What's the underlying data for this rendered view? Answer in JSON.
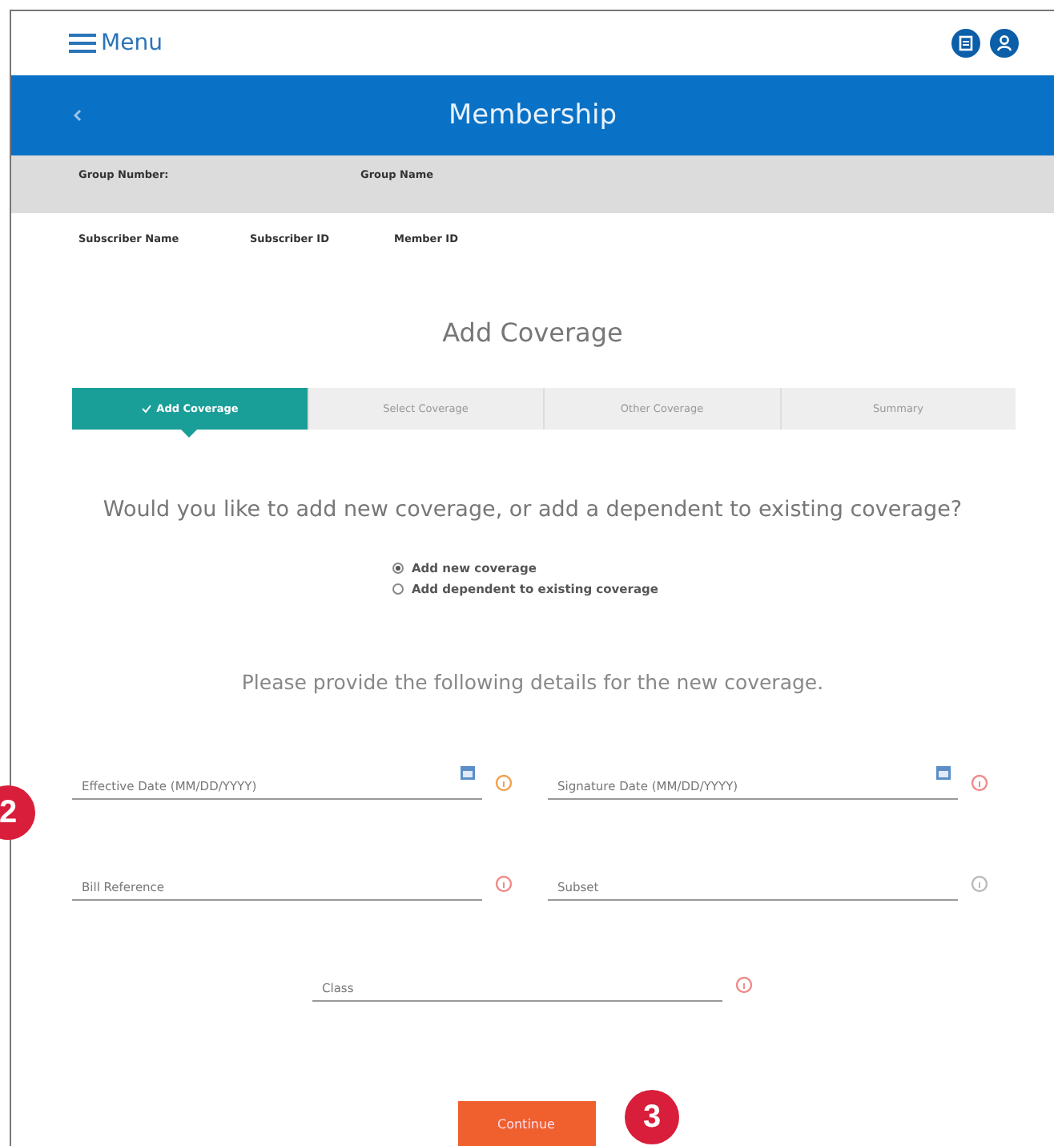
{
  "header": {
    "menu_label": "Menu"
  },
  "banner": {
    "title": "Membership"
  },
  "group_info": [
    {
      "label": "Group Number:"
    },
    {
      "label": "Group Name"
    }
  ],
  "subscriber_info": [
    {
      "label": "Subscriber Name"
    },
    {
      "label": "Subscriber ID"
    },
    {
      "label": "Member ID"
    }
  ],
  "page_title": "Add Coverage",
  "steps": [
    {
      "label": "Add Coverage",
      "selected": true
    },
    {
      "label": "Select Coverage",
      "selected": false
    },
    {
      "label": "Other Coverage",
      "selected": false
    },
    {
      "label": "Summary",
      "selected": false
    }
  ],
  "question": "Would you like to add new coverage, or add a dependent to existing coverage?",
  "options": [
    {
      "label": "Add new coverage",
      "selected": true
    },
    {
      "label": "Add dependent to existing coverage",
      "selected": false
    }
  ],
  "details_prompt": "Please provide the following details for the new coverage.",
  "field_rows": [
    [
      {
        "placeholder": "Effective Date (MM/DD/YYYY)",
        "kind": "date",
        "color": "#f0a050"
      },
      {
        "placeholder": "Signature Date (MM/DD/YYYY)",
        "kind": "date",
        "color": "#f08a8a"
      }
    ],
    [
      {
        "placeholder": "Bill Reference",
        "kind": "text",
        "color": "#f08a8a"
      },
      {
        "placeholder": "Subset",
        "kind": "text",
        "color": "#bbbbbb"
      }
    ],
    [
      {
        "placeholder": "Class",
        "kind": "text",
        "color": "#f08a8a"
      }
    ]
  ],
  "continue_button": "Continue",
  "callouts": [
    {
      "label": "2"
    },
    {
      "label": "3"
    }
  ]
}
